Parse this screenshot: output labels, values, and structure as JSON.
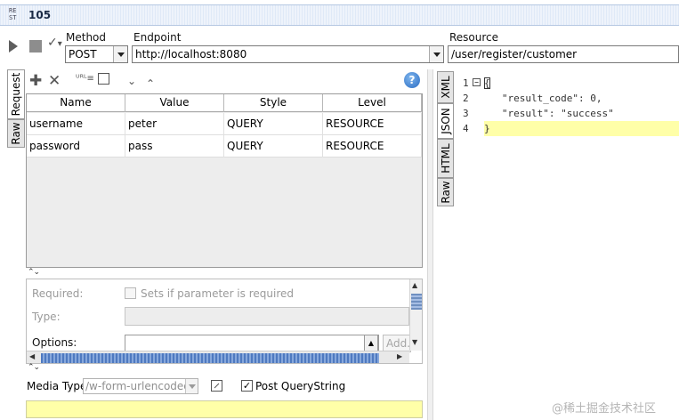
{
  "window": {
    "icon_text": "RE\nST",
    "title": "105"
  },
  "toolbar": {
    "method_label": "Method",
    "method_value": "POST",
    "endpoint_label": "Endpoint",
    "endpoint_value": "http://localhost:8080",
    "resource_label": "Resource",
    "resource_value": "/user/register/customer"
  },
  "left_tabs": [
    "Request",
    "Raw"
  ],
  "param_table": {
    "columns": [
      "Name",
      "Value",
      "Style",
      "Level"
    ],
    "rows": [
      {
        "name": "username",
        "value": "peter",
        "style": "QUERY",
        "level": "RESOURCE"
      },
      {
        "name": "password",
        "value": "pass",
        "style": "QUERY",
        "level": "RESOURCE"
      }
    ]
  },
  "param_details": {
    "required_label": "Required:",
    "required_hint": "Sets if parameter is required",
    "type_label": "Type:",
    "options_label": "Options:",
    "add_button": "Add..."
  },
  "media": {
    "label": "Media Type",
    "value": "/w-form-urlencoded",
    "post_querystring_label": "Post QueryString",
    "post_querystring_checked": true
  },
  "response_tabs": [
    "XML",
    "JSON",
    "HTML",
    "Raw"
  ],
  "response": {
    "lines": [
      "{",
      "   \"result_code\": 0,",
      "   \"result\": \"success\"",
      "}"
    ],
    "line_numbers": [
      "1",
      "2",
      "3",
      "4"
    ]
  },
  "watermark": "@稀土掘金技术社区",
  "colors": {
    "highlight": "#ffffa8",
    "title_bar": "#dfe9f7"
  }
}
